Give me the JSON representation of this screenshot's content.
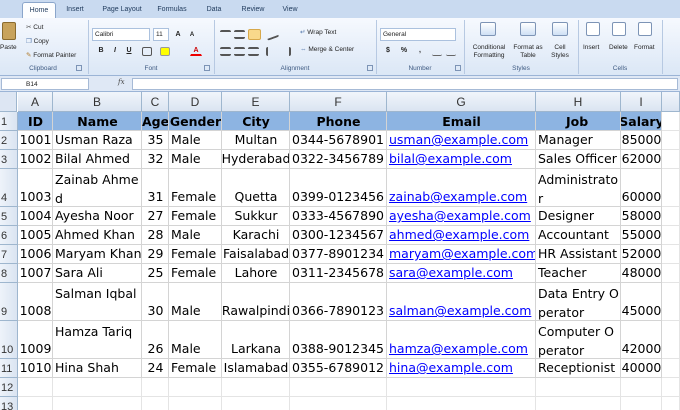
{
  "ribbon": {
    "tabs": [
      "Home",
      "Insert",
      "Page Layout",
      "Formulas",
      "Data",
      "Review",
      "View"
    ],
    "clipboard": {
      "paste": "Paste",
      "cut": "Cut",
      "copy": "Copy",
      "format_painter": "Format Painter",
      "label": "Clipboard"
    },
    "font": {
      "name": "Calibri",
      "size": "11",
      "bold": "B",
      "italic": "I",
      "underline": "U",
      "label": "Font"
    },
    "alignment": {
      "wrap_text": "Wrap Text",
      "merge_center": "Merge & Center",
      "label": "Alignment"
    },
    "number": {
      "format": "General",
      "currency": "$",
      "percent": "%",
      "comma": ",",
      "label": "Number"
    },
    "styles": {
      "conditional": "Conditional Formatting",
      "format_table": "Format as Table",
      "cell_styles": "Cell Styles",
      "label": "Styles"
    },
    "cells": {
      "insert": "Insert",
      "delete": "Delete",
      "format": "Format",
      "label": "Cells"
    }
  },
  "formula_bar": {
    "name_box": "B14",
    "fx": "fx",
    "value": ""
  },
  "sheet": {
    "column_letters": [
      "A",
      "B",
      "C",
      "D",
      "E",
      "F",
      "G",
      "H",
      "I"
    ],
    "row_numbers": [
      "1",
      "2",
      "3",
      "4",
      "5",
      "6",
      "7",
      "8",
      "9",
      "10",
      "11",
      "12",
      "13"
    ],
    "headers": [
      "ID",
      "Name",
      "Age",
      "Gender",
      "City",
      "Phone",
      "Email",
      "Job",
      "Salary"
    ],
    "rows": [
      [
        "1001",
        "Usman Raza",
        "35",
        "Male",
        "Multan",
        "0344-5678901",
        "usman@example.com",
        "Manager",
        "85000"
      ],
      [
        "1002",
        "Bilal Ahmed",
        "32",
        "Male",
        "Hyderabad",
        "0322-3456789",
        "bilal@example.com",
        "Sales Officer",
        "62000"
      ],
      [
        "1003",
        "Zainab Ahmed",
        "31",
        "Female",
        "Quetta",
        "0399-0123456",
        "zainab@example.com",
        "Administrator",
        "60000"
      ],
      [
        "1004",
        "Ayesha Noor",
        "27",
        "Female",
        "Sukkur",
        "0333-4567890",
        "ayesha@example.com",
        "Designer",
        "58000"
      ],
      [
        "1005",
        "Ahmed Khan",
        "28",
        "Male",
        "Karachi",
        "0300-1234567",
        "ahmed@example.com",
        "Accountant",
        "55000"
      ],
      [
        "1006",
        "Maryam Khan",
        "29",
        "Female",
        "Faisalabad",
        "0377-8901234",
        "maryam@example.com",
        "HR Assistant",
        "52000"
      ],
      [
        "1007",
        "Sara Ali",
        "25",
        "Female",
        "Lahore",
        "0311-2345678",
        "sara@example.com",
        "Teacher",
        "48000"
      ],
      [
        "1008",
        "Salman Iqbal",
        "30",
        "Male",
        "Rawalpindi",
        "0366-7890123",
        "salman@example.com",
        "Data Entry Operator",
        "45000"
      ],
      [
        "1009",
        "Hamza Tariq",
        "26",
        "Male",
        "Larkana",
        "0388-9012345",
        "hamza@example.com",
        "Computer Operator",
        "42000"
      ],
      [
        "1010",
        "Hina Shah",
        "24",
        "Female",
        "Islamabad",
        "0355-6789012",
        "hina@example.com",
        "Receptionist",
        "40000"
      ]
    ]
  },
  "colors": {
    "header_fill": "#8db4e2",
    "link": "#0000ff",
    "ribbon": "#dbe7f6"
  }
}
